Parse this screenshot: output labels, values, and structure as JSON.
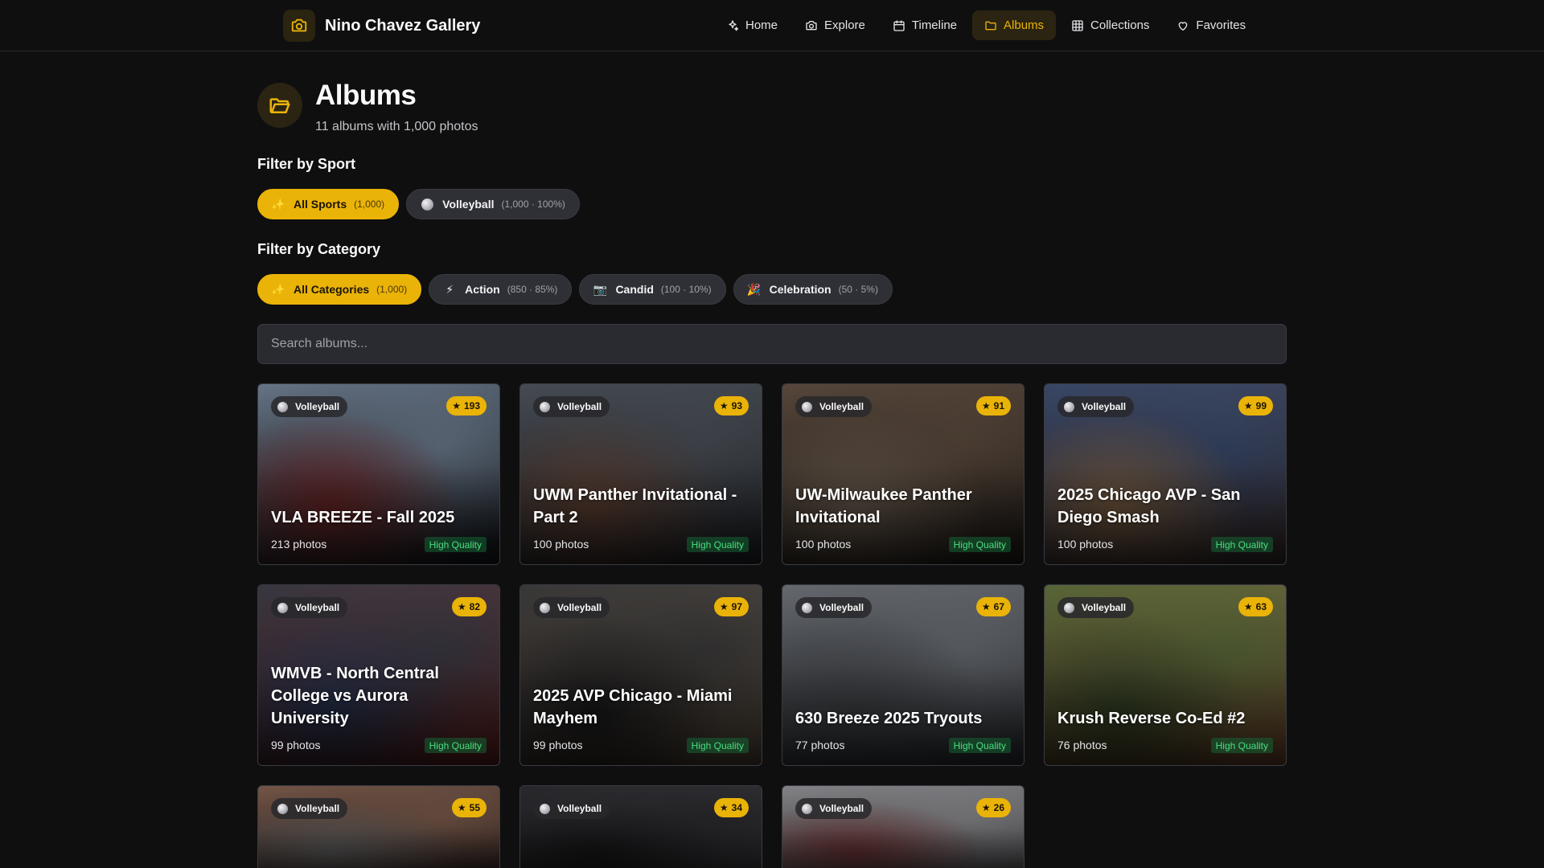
{
  "header": {
    "title": "Nino Chavez Gallery",
    "nav": [
      {
        "label": "Home",
        "icon": "sparkles-icon",
        "active": false
      },
      {
        "label": "Explore",
        "icon": "camera-icon",
        "active": false
      },
      {
        "label": "Timeline",
        "icon": "calendar-icon",
        "active": false
      },
      {
        "label": "Albums",
        "icon": "folder-icon",
        "active": true
      },
      {
        "label": "Collections",
        "icon": "grid-icon",
        "active": false
      },
      {
        "label": "Favorites",
        "icon": "heart-icon",
        "active": false
      }
    ]
  },
  "page": {
    "title": "Albums",
    "subtitle": "11 albums with 1,000 photos"
  },
  "filters": {
    "sport_label": "Filter by Sport",
    "sports": [
      {
        "icon": "✨",
        "label": "All Sports",
        "count": "(1,000)",
        "active": true
      },
      {
        "icon": "ball",
        "label": "Volleyball",
        "count": "(1,000 · 100%)",
        "active": false
      }
    ],
    "category_label": "Filter by Category",
    "categories": [
      {
        "icon": "✨",
        "label": "All Categories",
        "count": "(1,000)",
        "active": true
      },
      {
        "icon": "⚡",
        "label": "Action",
        "count": "(850 · 85%)",
        "active": false
      },
      {
        "icon": "📷",
        "label": "Candid",
        "count": "(100 · 10%)",
        "active": false
      },
      {
        "icon": "🎉",
        "label": "Celebration",
        "count": "(50 · 5%)",
        "active": false
      }
    ]
  },
  "search": {
    "placeholder": "Search albums..."
  },
  "albums": [
    {
      "sport": "Volleyball",
      "score": "193",
      "title": "VLA BREEZE - Fall 2025",
      "count": "213 photos",
      "quality": "High Quality",
      "colors": [
        "#6b7a8c",
        "#1c1f26",
        "#7a2a2a"
      ]
    },
    {
      "sport": "Volleyball",
      "score": "93",
      "title": "UWM Panther Invitational - Part 2",
      "count": "100 photos",
      "quality": "High Quality",
      "colors": [
        "#4a4f57",
        "#2b2e33",
        "#6d4a3a"
      ]
    },
    {
      "sport": "Volleyball",
      "score": "91",
      "title": "UW-Milwaukee Panther Invitational",
      "count": "100 photos",
      "quality": "High Quality",
      "colors": [
        "#5b4a3d",
        "#2a2521",
        "#7a6a5a"
      ]
    },
    {
      "sport": "Volleyball",
      "score": "99",
      "title": "2025 Chicago AVP - San Diego Smash",
      "count": "100 photos",
      "quality": "High Quality",
      "colors": [
        "#3a4a6b",
        "#4a3a3a",
        "#8a6a4a"
      ]
    },
    {
      "sport": "Volleyball",
      "score": "82",
      "title": "WMVB - North Central College vs Aurora University",
      "count": "99 photos",
      "quality": "High Quality",
      "colors": [
        "#3a3a44",
        "#7a2a2a",
        "#2a3a5a"
      ]
    },
    {
      "sport": "Volleyball",
      "score": "97",
      "title": "2025 AVP Chicago - Miami Mayhem",
      "count": "99 photos",
      "quality": "High Quality",
      "colors": [
        "#3b3a3a",
        "#6a5a4a",
        "#1e1e20"
      ]
    },
    {
      "sport": "Volleyball",
      "score": "67",
      "title": "630 Breeze 2025 Tryouts",
      "count": "77 photos",
      "quality": "High Quality",
      "colors": [
        "#6a6e74",
        "#3a3d42",
        "#4a4d52"
      ]
    },
    {
      "sport": "Volleyball",
      "score": "63",
      "title": "Krush Reverse Co-Ed #2",
      "count": "76 photos",
      "quality": "High Quality",
      "colors": [
        "#5a6a3a",
        "#8a5a3a",
        "#3a4a2a"
      ]
    },
    {
      "sport": "Volleyball",
      "score": "55",
      "title": "",
      "count": "",
      "quality": "",
      "colors": [
        "#7a5a4a",
        "#3a2a2a",
        "#6a6a6a"
      ]
    },
    {
      "sport": "Volleyball",
      "score": "34",
      "title": "",
      "count": "",
      "quality": "",
      "colors": [
        "#2a2a2e",
        "#3a3a3e",
        "#1a1a1c"
      ]
    },
    {
      "sport": "Volleyball",
      "score": "26",
      "title": "",
      "count": "",
      "quality": "",
      "colors": [
        "#8a8a8e",
        "#5a5a5e",
        "#7a3a3a"
      ]
    }
  ]
}
